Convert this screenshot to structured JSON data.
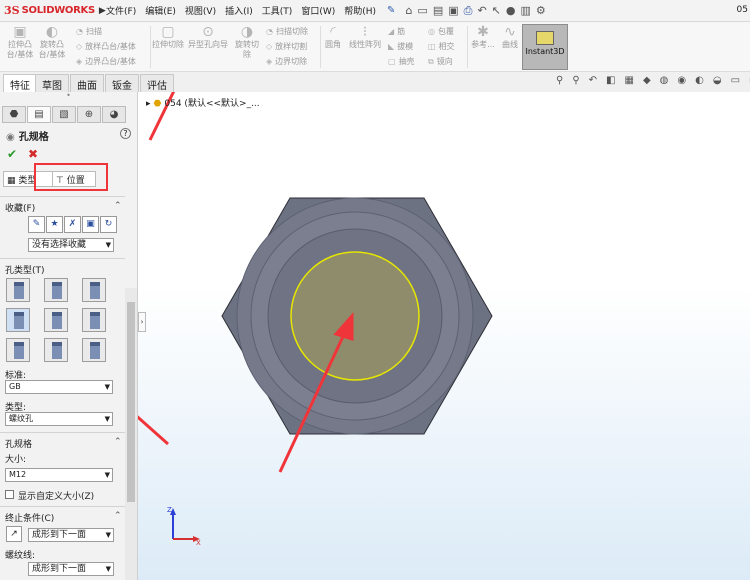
{
  "app": {
    "logo_ds": "3S",
    "logo_text": "SOLIDWORKS",
    "corner_text": "05"
  },
  "menu": [
    "文件(F)",
    "编辑(E)",
    "视图(V)",
    "插入(I)",
    "工具(T)",
    "窗口(W)",
    "帮助(H)"
  ],
  "commands": {
    "boss_extrude": "拉伸凸台/基体",
    "boss_revolve": "旋转凸台/基体",
    "sweep": "扫描",
    "loft": "放样凸台/基体",
    "boundary_boss": "边界凸台/基体",
    "cut_extrude": "拉伸切除",
    "hole_wizard": "异型孔向导",
    "cut_revolve": "旋转切除",
    "swept_cut": "扫描切除",
    "lofted_cut": "放样切割",
    "boundary_cut": "边界切除",
    "fillet": "圆角",
    "linear_pattern": "线性阵列",
    "rib": "筋",
    "draft": "拔模",
    "shell": "抽壳",
    "wrap": "包覆",
    "intersect": "相交",
    "mirror": "镜向",
    "reference": "参考...",
    "curves": "曲线",
    "instant3d": "Instant3D"
  },
  "tabs": [
    "特征",
    "草图",
    "曲面",
    "钣金",
    "评估"
  ],
  "tree": {
    "node_text": "054  (默认<<默认>_..."
  },
  "panel": {
    "title": "孔规格",
    "help": "?",
    "subtabs": {
      "type": "类型",
      "position": "位置"
    },
    "favorites": {
      "heading": "收藏(F)",
      "selection": "没有选择收藏"
    },
    "hole_type": {
      "heading": "孔类型(T)",
      "standard_label": "标准:",
      "standard_value": "GB",
      "type_label": "类型:",
      "type_value": "螺纹孔"
    },
    "hole_spec": {
      "heading": "孔规格",
      "size_label": "大小:",
      "size_value": "M12",
      "custom_size": "显示自定义大小(Z)"
    },
    "end_condition": {
      "heading": "终止条件(C)",
      "value": "成形到下一面",
      "thread_label": "螺纹线:",
      "thread_value": "成形到下一面"
    }
  },
  "colors": {
    "annotation_red": "#f0353a",
    "hex_face": "#6d7282",
    "hole_face": "#8e8c6a",
    "selection_yellow": "#e6e600",
    "logo_red": "#d8262b"
  },
  "triad": {
    "x_label": "X",
    "z_label": "Z"
  }
}
